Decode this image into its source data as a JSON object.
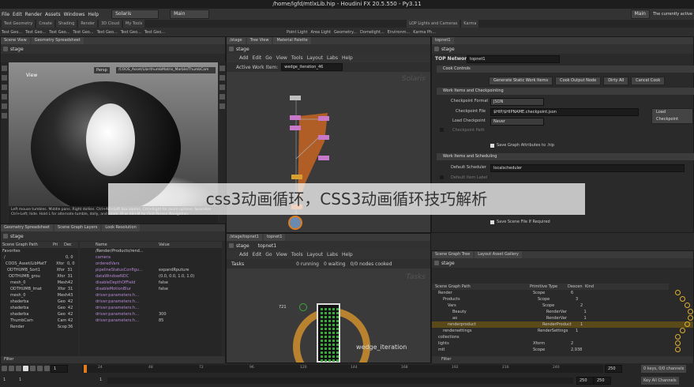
{
  "window": {
    "title": "/home/lgfd/mtlxLib.hip - Houdini FX 20.5.550 - Py3.11"
  },
  "menubar": {
    "items": [
      "File",
      "Edit",
      "Render",
      "Assets",
      "Windows",
      "Help"
    ],
    "desktop": "Solaris",
    "main_dd": "Main",
    "right_label": "Main",
    "right_status": "The currently active"
  },
  "toolrow": {
    "tabs": [
      "Test Geometry",
      "Create",
      "Shading",
      "Render",
      "3D Cloud",
      "My Tools"
    ]
  },
  "shelf": {
    "left": [
      "Test Geo...",
      "Test Geo...",
      "Test Geo...",
      "Test Geo...",
      "Test Geo...",
      "Test Geo...",
      "Test Geo..."
    ],
    "right": [
      "Point Light",
      "Area Light",
      "Geometry...",
      "Domelight...",
      "Environm...",
      "Karma Ph..."
    ],
    "right_tabs": [
      "LOP Lights and Cameras",
      "Karma"
    ]
  },
  "viewport": {
    "tabs": [
      "Scene View",
      "Geometry Spreadsheet"
    ],
    "path": "stage",
    "view_label": "View",
    "camera_dd": "Persp",
    "cam_path": "/COOS_Asset/LibrithumbMatrix_Marble/ThumbCam",
    "status": "Left mouse tumbles. Middle pans. Right dollies. Ctrl+Alt+Left box zooms. Ctrl+Right for zoom options. Spacebar Ctrl+Left; hide. Hold L for alternate tumble, dolly, and zoom. M or Alt+M for First Person Navigation."
  },
  "network": {
    "tabs": [
      "/stage",
      "Tree View",
      "Material Palette"
    ],
    "path": "stage",
    "menu": [
      "Add",
      "Edit",
      "Go",
      "View",
      "Tools",
      "Layout",
      "Labs",
      "Help"
    ],
    "active_item_label": "Active Work Item:",
    "active_item_value": "wedge_iteration_46",
    "watermark_label": "Solaris"
  },
  "parms": {
    "tab": "topnet1",
    "path": "stage",
    "node_type": "TOP Network",
    "node_name": "topnet1",
    "cook_controls": "Cook Controls",
    "buttons": [
      "Generate Static Work Items",
      "Cook Output Node",
      "Dirty All",
      "Cancel Cook"
    ],
    "work_items_section": "Work Items and Checkpointing",
    "checkpoint_format_label": "Checkpoint Format",
    "checkpoint_format_value": "JSON",
    "checkpoint_file_label": "Checkpoint File",
    "checkpoint_file_value": "$HIP/$HIPNAME.checkpoint.json",
    "load_checkpoint_btn": "Load Checkpoint",
    "load_checkpoint_label": "Load Checkpoint",
    "load_checkpoint_value": "Never",
    "checkpoint_path_label": "Checkpoint Path",
    "save_graph_attrs": "Save Graph Attributes to .hip",
    "scheduling_section": "Work Items and Scheduling",
    "default_scheduler_label": "Default Scheduler",
    "default_scheduler_value": "localscheduler",
    "default_item_label": "Default Item Label",
    "save_scene_required": "Save Scene File If Required"
  },
  "spreadsheet": {
    "tabs": [
      "Geometry Spreadsheet",
      "Scene Graph Layers",
      "Look Resolution"
    ],
    "path": "stage",
    "cols": [
      "Scene Graph Path",
      "Pri",
      "Dec"
    ],
    "rows": [
      {
        "name": "Favorites",
        "a": "",
        "b": ""
      },
      {
        "name": "/",
        "a": "",
        "b": "0, 0"
      },
      {
        "name": "COOS_Asset/LibMatT",
        "a": "Xfor",
        "b": "0, 0"
      },
      {
        "name": "ODTHUMB_Sort1",
        "a": "Xfor",
        "b": "31"
      },
      {
        "name": "ODTHUMB_grou",
        "a": "Xfor",
        "b": "31"
      },
      {
        "name": "mesh_0",
        "a": "Mesh",
        "b": "42"
      },
      {
        "name": "ODTHUMB_Imat",
        "a": "Xfor",
        "b": "31"
      },
      {
        "name": "mesh_0",
        "a": "Mesh",
        "b": "43"
      },
      {
        "name": "shaderba",
        "a": "Geo",
        "b": "42"
      },
      {
        "name": "shaderba",
        "a": "Geo",
        "b": "42"
      },
      {
        "name": "shaderba",
        "a": "Geo",
        "b": "42"
      },
      {
        "name": "ThumbCam",
        "a": "Cam",
        "b": "42"
      },
      {
        "name": "Render",
        "a": "Scop",
        "b": "36"
      }
    ],
    "attr_cols": [
      "Name",
      "Value"
    ],
    "attrs": [
      {
        "name": "/Render/Products/rend...",
        "value": ""
      },
      {
        "name": "camera",
        "value": ""
      },
      {
        "name": "orderedVars",
        "value": ""
      },
      {
        "name": "pipelineStatusConfigu...",
        "value": "expandRputure"
      },
      {
        "name": "dataWindowNDC",
        "value": "(0.0, 0.0, 1.0, 1.0)"
      },
      {
        "name": "disableDepthOfField",
        "value": "false"
      },
      {
        "name": "disableMotionBlur",
        "value": "false"
      },
      {
        "name": "driver:parameters:h...",
        "value": ""
      },
      {
        "name": "driver:parameters:h...",
        "value": ""
      },
      {
        "name": "driver:parameters:h...",
        "value": ""
      },
      {
        "name": "driver:parameters:h...",
        "value": "300"
      },
      {
        "name": "driver:parameters:h...",
        "value": "85"
      }
    ],
    "filter": "Filter"
  },
  "tasks": {
    "tabs": [
      "/stage/topnet1",
      "topnet1"
    ],
    "path": "stage",
    "path2": "topnet1",
    "menu": [
      "Add",
      "Edit",
      "Go",
      "View",
      "Tools",
      "Layout",
      "Labs",
      "Help"
    ],
    "header": "Tasks",
    "running": "0 running",
    "waiting": "0 waiting",
    "cooked": "0/0 nodes cooked",
    "count": "721",
    "node_label": "wedge_iteration",
    "watermark": "Tasks"
  },
  "scenegraph": {
    "tabs": [
      "Scene Graph Tree",
      "Layout Asset Gallery"
    ],
    "path": "stage",
    "cols": [
      "Scene Graph Path",
      "Primitive Type",
      "Descen",
      "Kind"
    ],
    "rows": [
      {
        "name": "Render",
        "type": "Scope",
        "desc": "6",
        "kind": ""
      },
      {
        "name": "Products",
        "type": "Scope",
        "desc": "3",
        "kind": ""
      },
      {
        "name": "Vars",
        "type": "Scope",
        "desc": "2",
        "kind": ""
      },
      {
        "name": "Beauty",
        "type": "RenderVar",
        "desc": "1",
        "kind": ""
      },
      {
        "name": "ao",
        "type": "RenderVar",
        "desc": "1",
        "kind": ""
      },
      {
        "name": "renderproduct",
        "type": "RenderProduct",
        "desc": "1",
        "kind": ""
      },
      {
        "name": "rendersettings",
        "type": "RenderSettings",
        "desc": "1",
        "kind": ""
      },
      {
        "name": "collections",
        "type": "",
        "desc": "",
        "kind": ""
      },
      {
        "name": "lights",
        "type": "Xform",
        "desc": "2",
        "kind": ""
      },
      {
        "name": "mtl",
        "type": "Scope",
        "desc": "2,938",
        "kind": ""
      }
    ],
    "filter": "Filter"
  },
  "timeline": {
    "frame": "1",
    "start": "1",
    "end": "1",
    "range_start": "1",
    "range_end": "1",
    "end_a": "250",
    "end_b": "250",
    "keys_label": "0 keys, 0/0 channels",
    "key_all": "Key All Channels",
    "ticks": [
      "24",
      "48",
      "72",
      "96",
      "120",
      "144",
      "168",
      "192",
      "216",
      "240"
    ]
  },
  "overlay": {
    "text": "css3动画循环，CSS3动画循环技巧解析"
  },
  "colors": {
    "accent_orange": "#e07c1f",
    "selected_row": "#5a4a1a",
    "node_green": "#3aa83a",
    "purple_attr": "#b48ad6"
  }
}
